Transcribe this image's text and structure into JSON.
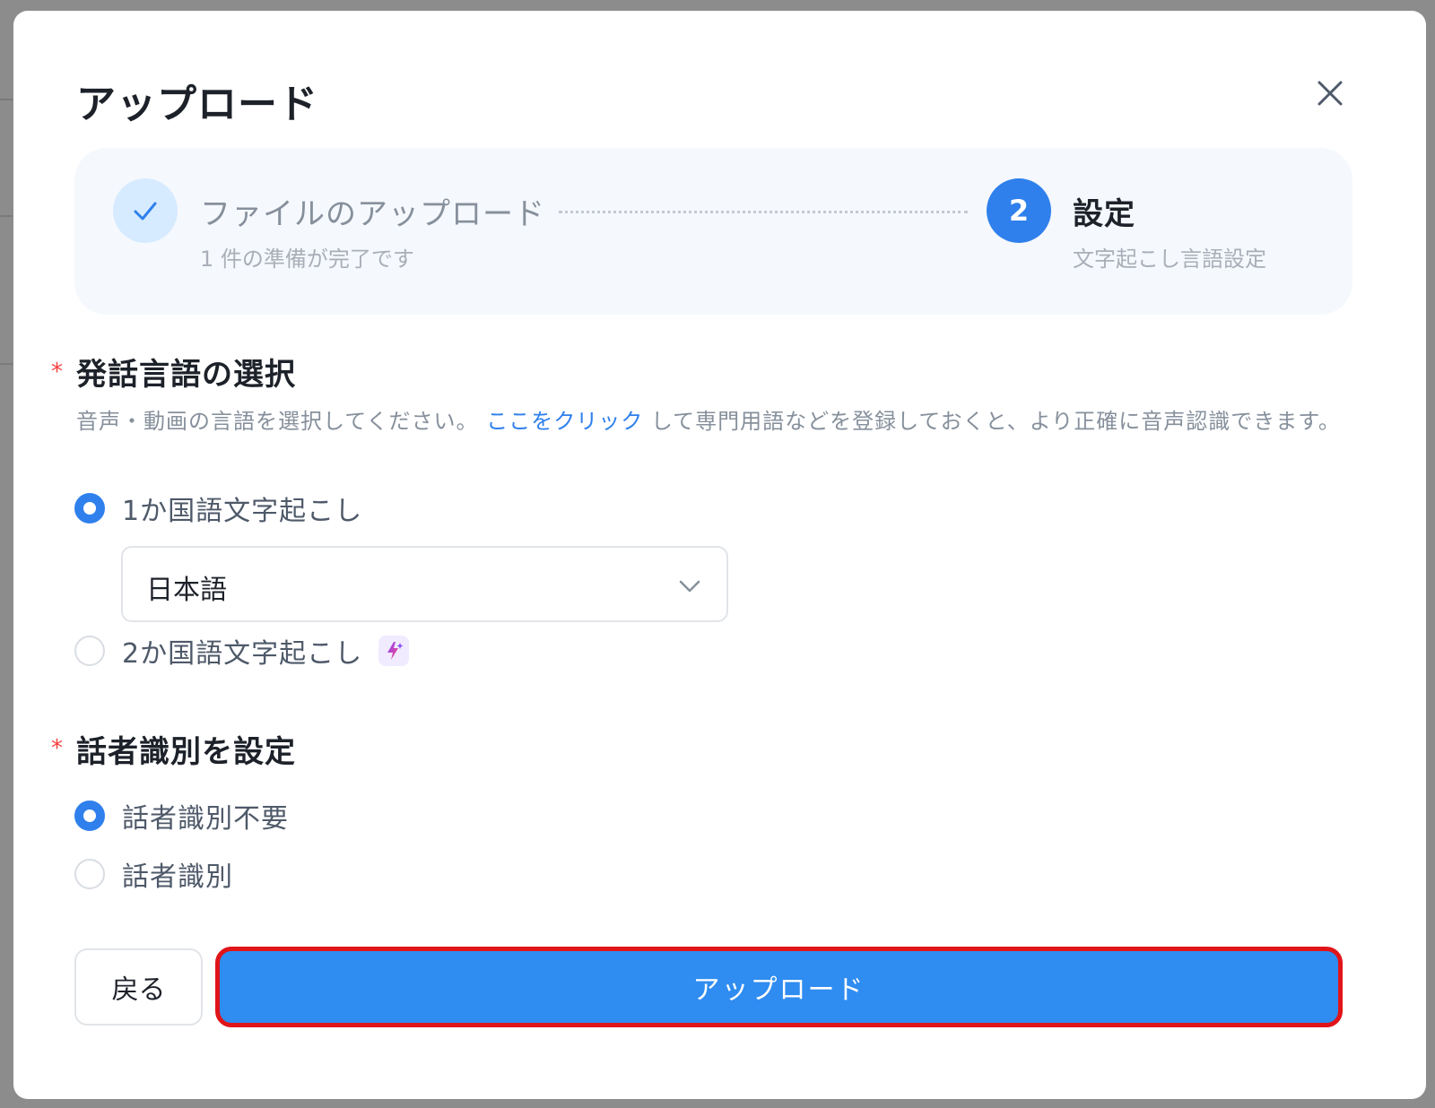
{
  "modal": {
    "title": "アップロード"
  },
  "steps": [
    {
      "number": "1",
      "title": "ファイルのアップロード",
      "subtitle": "1 件の準備が完了です",
      "status": "completed"
    },
    {
      "number": "2",
      "title": "設定",
      "subtitle": "文字起こし言語設定",
      "status": "active"
    }
  ],
  "language_section": {
    "required_mark": "*",
    "title": "発話言語の選択",
    "description_before": "音声・動画の言語を選択してください。",
    "description_link": "ここをクリック",
    "description_after": "して専門用語などを登録しておくと、より正確に音声認識できます。",
    "options": [
      {
        "label": "1か国語文字起こし",
        "selected": true
      },
      {
        "label": "2か国語文字起こし",
        "selected": false
      }
    ],
    "select_value": "日本語"
  },
  "speaker_section": {
    "required_mark": "*",
    "title": "話者識別を設定",
    "options": [
      {
        "label": "話者識別不要",
        "selected": true
      },
      {
        "label": "話者識別",
        "selected": false
      }
    ]
  },
  "footer": {
    "back_label": "戻る",
    "upload_label": "アップロード"
  },
  "colors": {
    "accent": "#2f80ec",
    "highlight_border": "#e01419",
    "required": "#f53f3f"
  },
  "icons": {
    "close": "close-icon",
    "step_done": "check-icon",
    "dropdown": "chevron-down-icon",
    "ai_badge": "sparkle-icon"
  }
}
